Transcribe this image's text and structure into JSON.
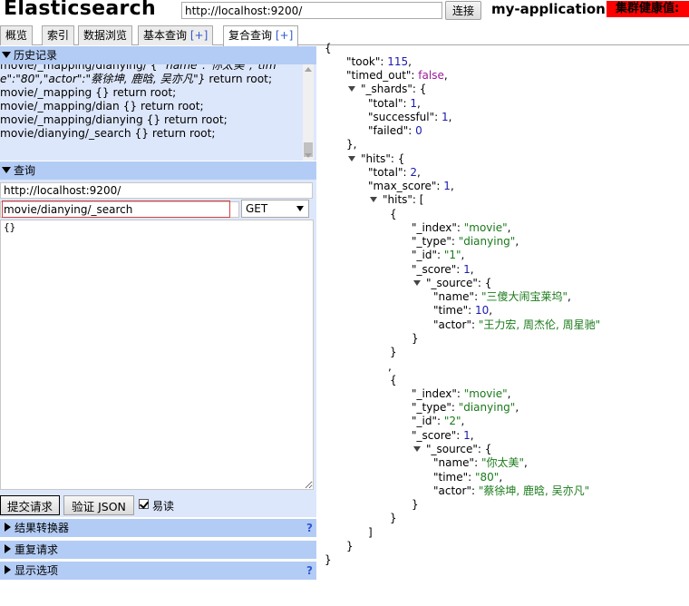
{
  "header": {
    "app_title": "Elasticsearch",
    "url": "http://localhost:9200/",
    "connect_label": "连接",
    "cluster_name": "my-application",
    "health_label": "集群健康值:"
  },
  "tabs": [
    {
      "label": "概览"
    },
    {
      "label": "索引"
    },
    {
      "label": "数据浏览"
    },
    {
      "label": "基本查询",
      "plus": "[+]"
    },
    {
      "label": "复合查询",
      "plus": "[+]"
    }
  ],
  "history": {
    "title": "历史记录",
    "items": [
      {
        "p1": "movie/_mapping/dianying/ {",
        "p2": " \"name\":\"你太",
        "p3": "美\",\"time\":\"80\",\"actor\":\"蔡徐坤, 鹿晗, 吴亦凡\"}",
        "p4": " return root;"
      },
      {
        "text": "movie/_mapping {} return root;"
      },
      {
        "text": "movie/_mapping/dian {} return root;"
      },
      {
        "text": "movie/_mapping/dianying {} return root;"
      },
      {
        "text": "movie/dianying/_search {} return root;"
      }
    ]
  },
  "query": {
    "title": "查询",
    "url": "http://localhost:9200/",
    "path": "movie/dianying/_search",
    "method": "GET",
    "body": "{}"
  },
  "actions": {
    "submit_label": "提交请求",
    "validate_label": "验证 JSON",
    "pretty_label": "易读",
    "pretty_checked": true
  },
  "panels": [
    {
      "title": "结果转换器",
      "help": "?"
    },
    {
      "title": "重复请求",
      "help": ""
    },
    {
      "title": "显示选项",
      "help": "?"
    }
  ],
  "result": {
    "took": "115",
    "timed_out": "false",
    "shards_total": "1",
    "shards_successful": "1",
    "shards_failed": "0",
    "hits_total": "2",
    "max_score": "1",
    "hits": [
      {
        "index": "\"movie\"",
        "type": "\"dianying\"",
        "id": "\"1\"",
        "score": "1",
        "name": "\"三傻大闹宝莱坞\"",
        "time": "10",
        "actor": "\"王力宏, 周杰伦, 周星驰\""
      },
      {
        "index": "\"movie\"",
        "type": "\"dianying\"",
        "id": "\"2\"",
        "score": "1",
        "name": "\"你太美\"",
        "time": "\"80\"",
        "actor": "\"蔡徐坤, 鹿晗, 吴亦凡\""
      }
    ]
  },
  "colors": {
    "health": "#ff0000",
    "section_head": "#b3ccf5",
    "panel_bg": "#dde7fb",
    "json_string": "#1a7a1a",
    "json_number": "#1a1ab0",
    "json_keyword": "#9a1a9a"
  }
}
